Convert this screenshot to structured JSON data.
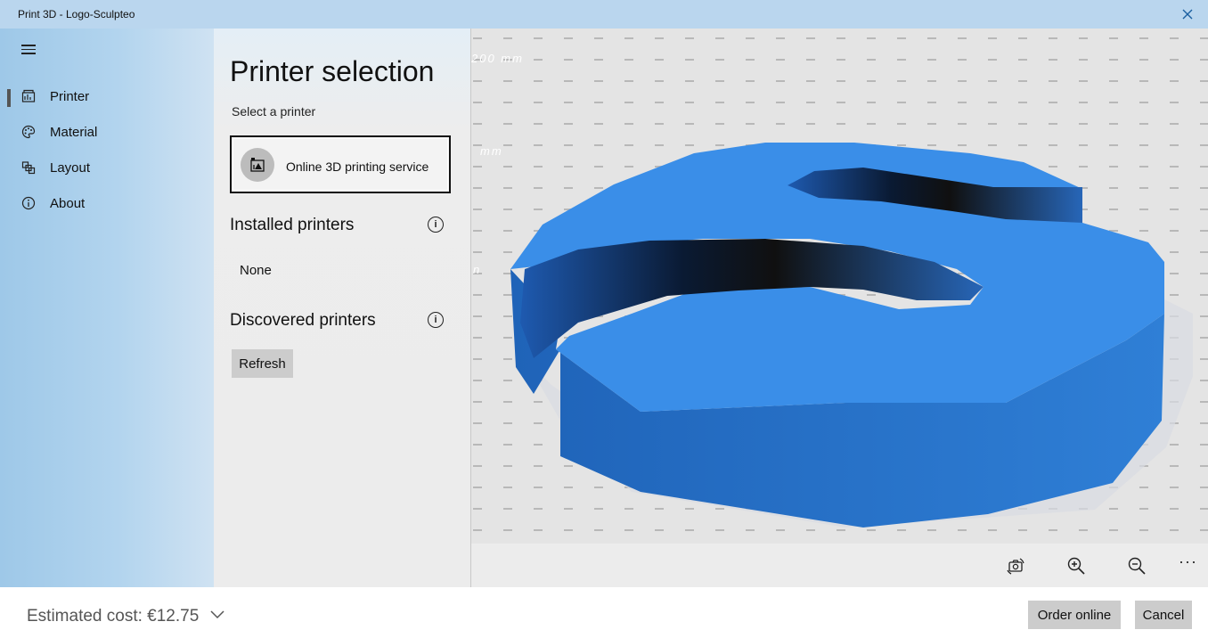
{
  "window": {
    "title": "Print 3D - Logo-Sculpteo"
  },
  "nav": {
    "items": [
      {
        "label": "Printer",
        "icon": "printer-icon"
      },
      {
        "label": "Material",
        "icon": "palette-icon"
      },
      {
        "label": "Layout",
        "icon": "cubes-icon"
      },
      {
        "label": "About",
        "icon": "info-icon"
      }
    ],
    "active": "Printer"
  },
  "panel": {
    "title": "Printer selection",
    "subtitle": "Select a printer",
    "online_service": "Online 3D printing service",
    "installed_heading": "Installed printers",
    "installed_value": "None",
    "discovered_heading": "Discovered printers",
    "refresh_label": "Refresh"
  },
  "viewport": {
    "labels": [
      "200 mm",
      "mm",
      "n"
    ],
    "model_color": "#3a8ee8",
    "toolbar_icons": [
      "reset-view-icon",
      "zoom-in-icon",
      "zoom-out-icon",
      "more-icon"
    ],
    "more_label": "···"
  },
  "footer": {
    "estimated_cost": "Estimated cost: €12.75",
    "order_label": "Order online",
    "cancel_label": "Cancel"
  }
}
